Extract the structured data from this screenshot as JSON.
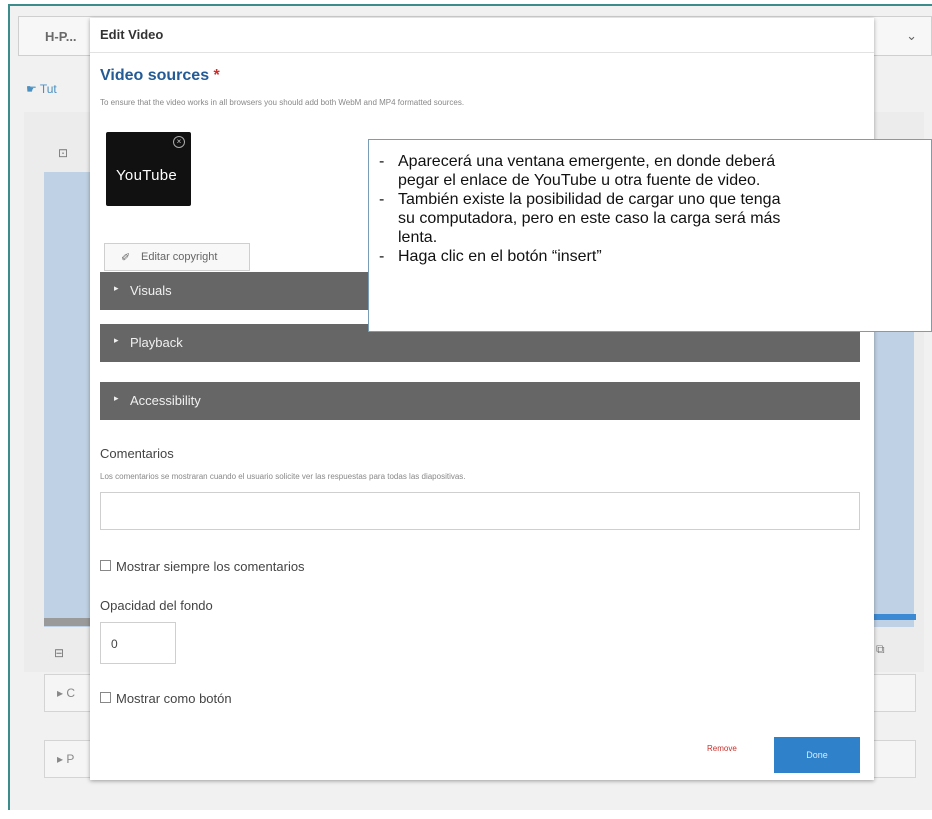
{
  "background_editor": {
    "topbar_label": "H-P...",
    "tab_label": "Tut",
    "row1_label": "▸ C",
    "row2_label": "▸ P"
  },
  "modal": {
    "title": "Edit Video",
    "video_sources": {
      "title": "Video sources",
      "required_marker": "*",
      "description": "To ensure that the video works in all browsers you should add both WebM and MP4 formatted sources.",
      "thumbnail_text": "YouTube",
      "copyright_button": "Editar copyright"
    },
    "accordions": [
      {
        "label": "Visuals"
      },
      {
        "label": "Playback"
      },
      {
        "label": "Accessibility"
      }
    ],
    "feedback": {
      "title": "Comentarios",
      "description": "Los comentarios se mostraran cuando el usuario solicite ver las respuestas para todas las diapositivas.",
      "value": ""
    },
    "show_feedback_checkbox": "Mostrar siempre los comentarios",
    "opacity": {
      "title": "Opacidad del fondo",
      "value": "0"
    },
    "show_as_button_checkbox": "Mostrar como botón",
    "remove_label": "Remove",
    "done_label": "Done"
  },
  "callout": {
    "lines": [
      "Aparecerá una ventana emergente, en donde deberá",
      "pegar el enlace de YouTube u otra fuente de video.",
      "También existe la posibilidad de cargar uno que tenga",
      "su computadora, pero en este caso la carga será más",
      "lenta.",
      "Haga clic en el botón “insert”"
    ]
  }
}
